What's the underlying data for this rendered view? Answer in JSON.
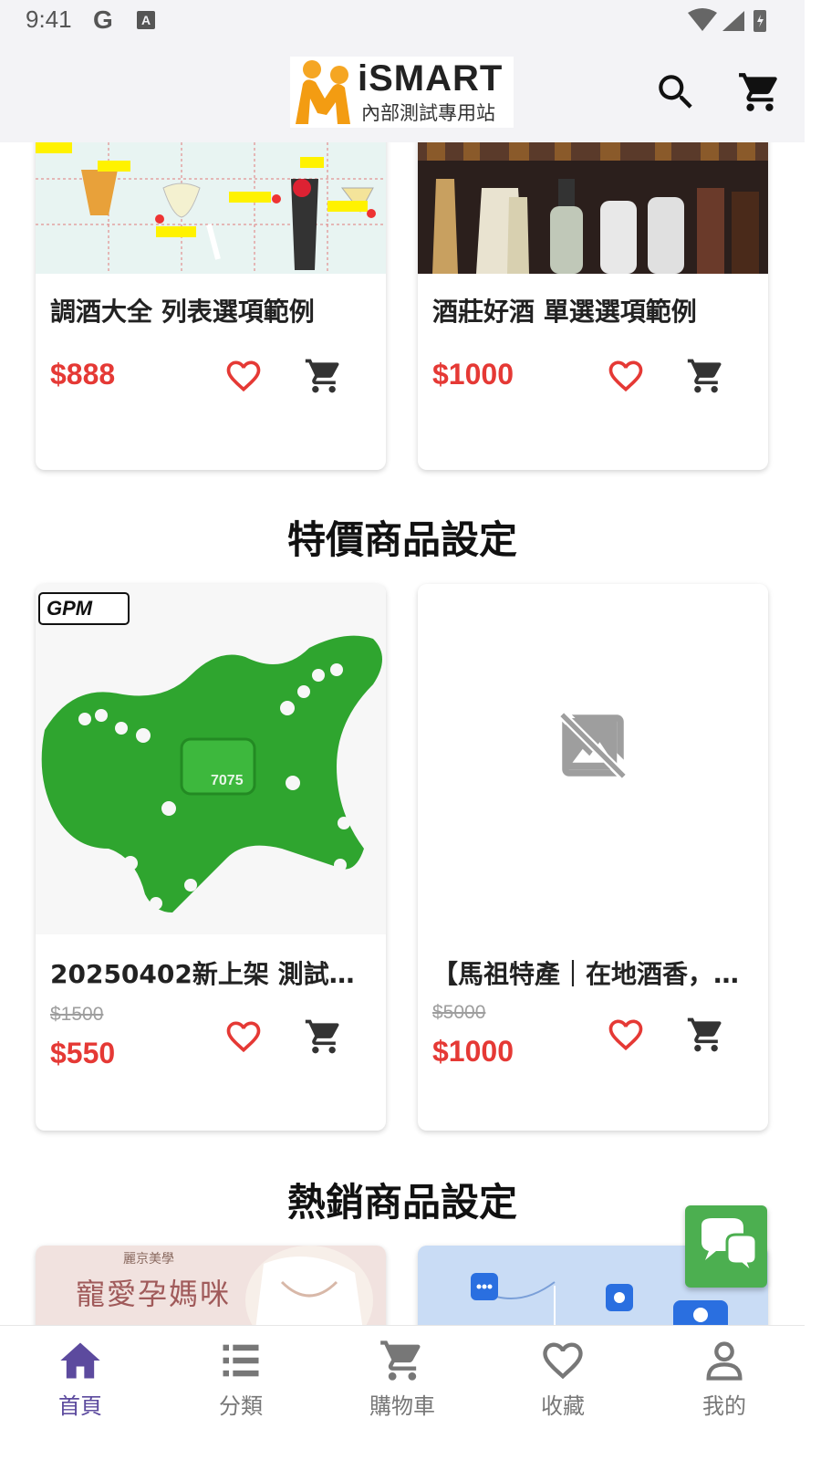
{
  "status_bar": {
    "time": "9:41",
    "g_glyph": "G",
    "a_glyph": "A"
  },
  "app_bar": {
    "logo_text": "iSMART",
    "logo_subtitle": "內部測試專用站",
    "search_icon": "search-icon",
    "cart_icon": "cart-icon"
  },
  "featured_products": [
    {
      "name": "調酒大全  列表選項範例",
      "price": "$888"
    },
    {
      "name": "酒莊好酒 單選選項範例",
      "price": "$1000"
    }
  ],
  "special_section": {
    "title": "特價商品設定",
    "products": [
      {
        "name": "20250402新上架 測試商…",
        "original_price": "$1500",
        "price": "$550",
        "image": "gpm-racing-green-part",
        "image_text": "7075"
      },
      {
        "name": "【馬祖特產｜在地酒香，…",
        "original_price": "$5000",
        "price": "$1000",
        "image": "image-not-available-icon"
      }
    ]
  },
  "hot_section": {
    "title": "熱銷商品設定",
    "products": [
      {
        "banner_text": "寵愛孕媽咪",
        "banner_sub": "麗京美學"
      },
      {
        "image": "chat-network-banner"
      }
    ]
  },
  "chat_button": {
    "icon": "chat-bubbles-icon"
  },
  "bottom_nav": [
    {
      "label": "首頁",
      "icon": "home-icon",
      "active": true
    },
    {
      "label": "分類",
      "icon": "list-icon",
      "active": false
    },
    {
      "label": "購物車",
      "icon": "cart-icon",
      "active": false
    },
    {
      "label": "收藏",
      "icon": "heart-icon",
      "active": false
    },
    {
      "label": "我的",
      "icon": "person-icon",
      "active": false
    }
  ],
  "colors": {
    "price": "#e53935",
    "heart": "#e53935",
    "active_nav": "#5c4a9e",
    "chat_fab": "#4caf50",
    "app_bar_bg": "#f3f3f6"
  }
}
